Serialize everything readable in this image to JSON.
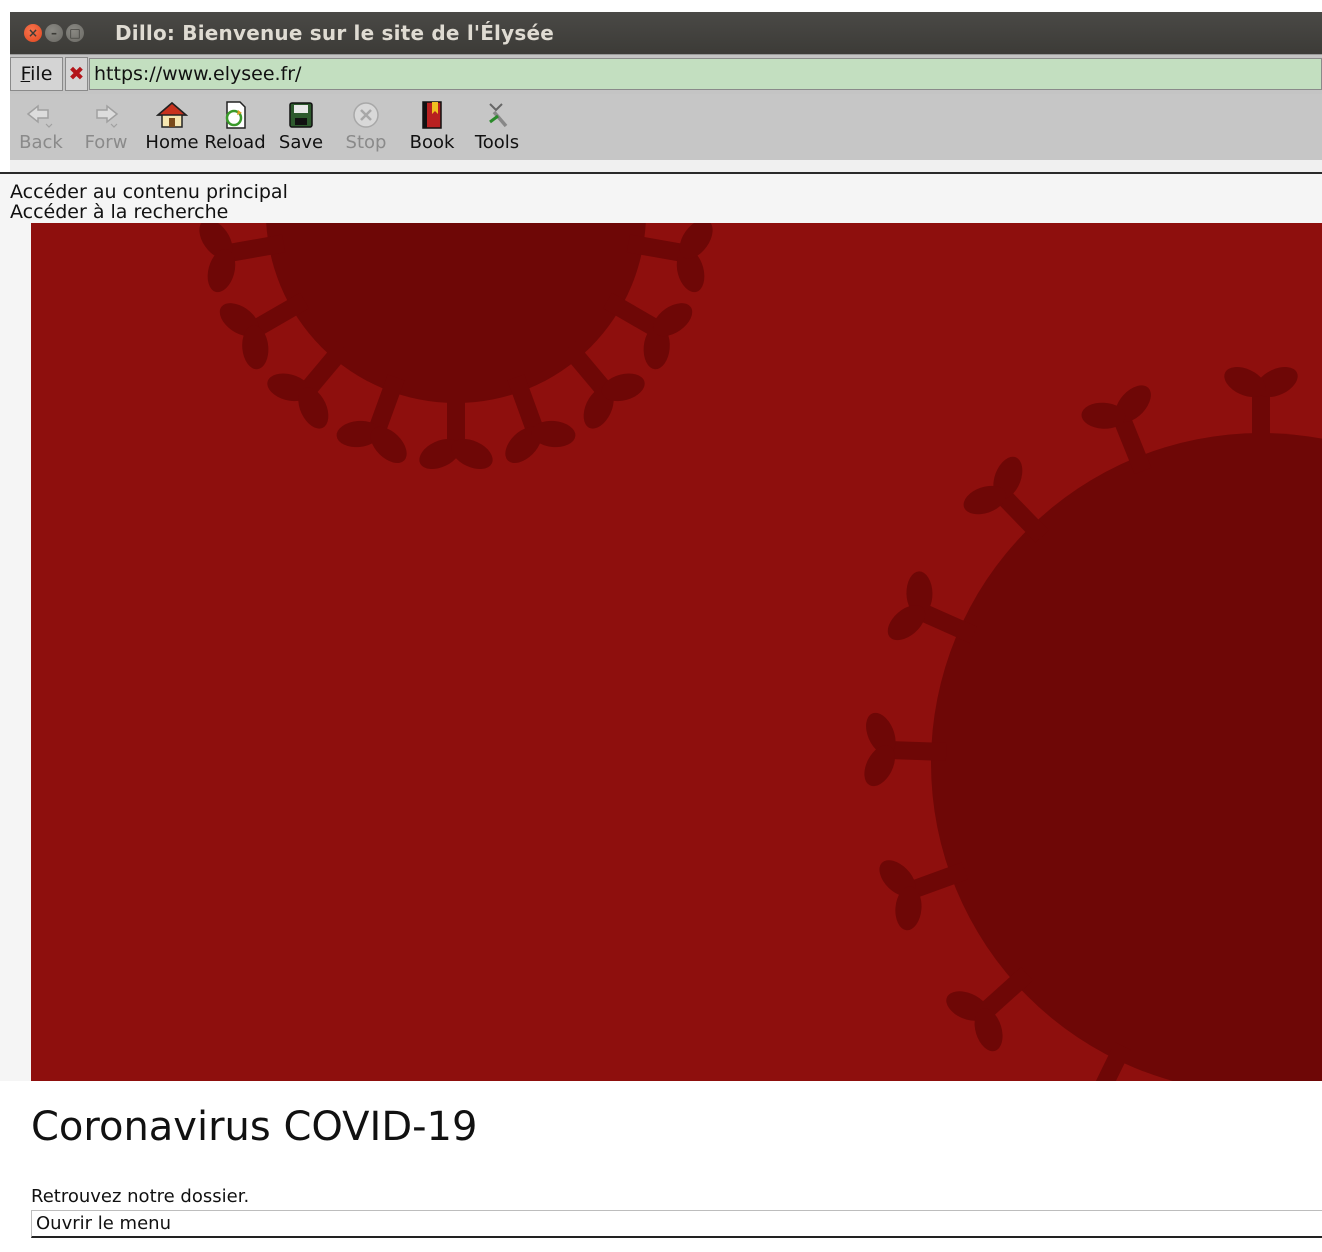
{
  "window": {
    "title": "Dillo: Bienvenue sur le site de l'Élysée",
    "close_glyph": "×",
    "min_glyph": "–",
    "max_glyph": "□"
  },
  "location": {
    "file_menu": "File",
    "clear_glyph": "✖",
    "url": "https://www.elysee.fr/"
  },
  "toolbar": {
    "buttons": [
      {
        "label": "Back",
        "icon": "back-arrow-icon",
        "enabled": false
      },
      {
        "label": "Forw",
        "icon": "forward-arrow-icon",
        "enabled": false
      },
      {
        "label": "Home",
        "icon": "home-icon",
        "enabled": true
      },
      {
        "label": "Reload",
        "icon": "reload-icon",
        "enabled": true
      },
      {
        "label": "Save",
        "icon": "save-icon",
        "enabled": true
      },
      {
        "label": "Stop",
        "icon": "stop-icon",
        "enabled": false
      },
      {
        "label": "Book",
        "icon": "bookmark-icon",
        "enabled": true
      },
      {
        "label": "Tools",
        "icon": "tools-icon",
        "enabled": true
      }
    ]
  },
  "page": {
    "skip_links": [
      "Accéder au contenu principal",
      "Accéder à la recherche"
    ],
    "hero": {
      "image": "coronavirus-illustration",
      "background": "#8e0f0d",
      "virus_color": "#6e0706"
    },
    "headline": "Coronavirus COVID-19",
    "subtext": "Retrouvez notre dossier.",
    "menu_button": "Ouvrir le menu"
  }
}
